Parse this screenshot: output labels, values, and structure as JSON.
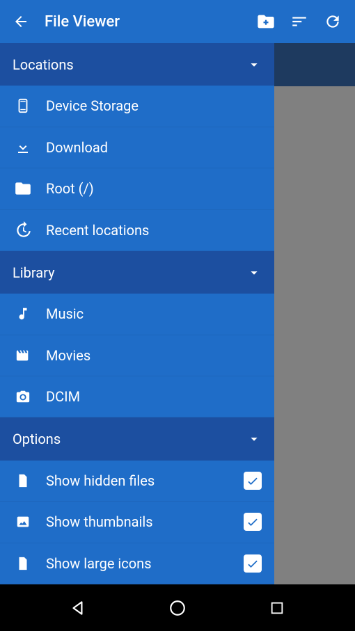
{
  "toolbar": {
    "title": "File Viewer"
  },
  "sections": {
    "locations": {
      "header": "Locations",
      "items": [
        {
          "label": "Device Storage"
        },
        {
          "label": "Download"
        },
        {
          "label": "Root (/)"
        },
        {
          "label": "Recent locations"
        }
      ]
    },
    "library": {
      "header": "Library",
      "items": [
        {
          "label": "Music"
        },
        {
          "label": "Movies"
        },
        {
          "label": "DCIM"
        }
      ]
    },
    "options": {
      "header": "Options",
      "items": [
        {
          "label": "Show hidden files",
          "checked": true
        },
        {
          "label": "Show thumbnails",
          "checked": true
        },
        {
          "label": "Show large icons",
          "checked": true
        }
      ]
    }
  }
}
